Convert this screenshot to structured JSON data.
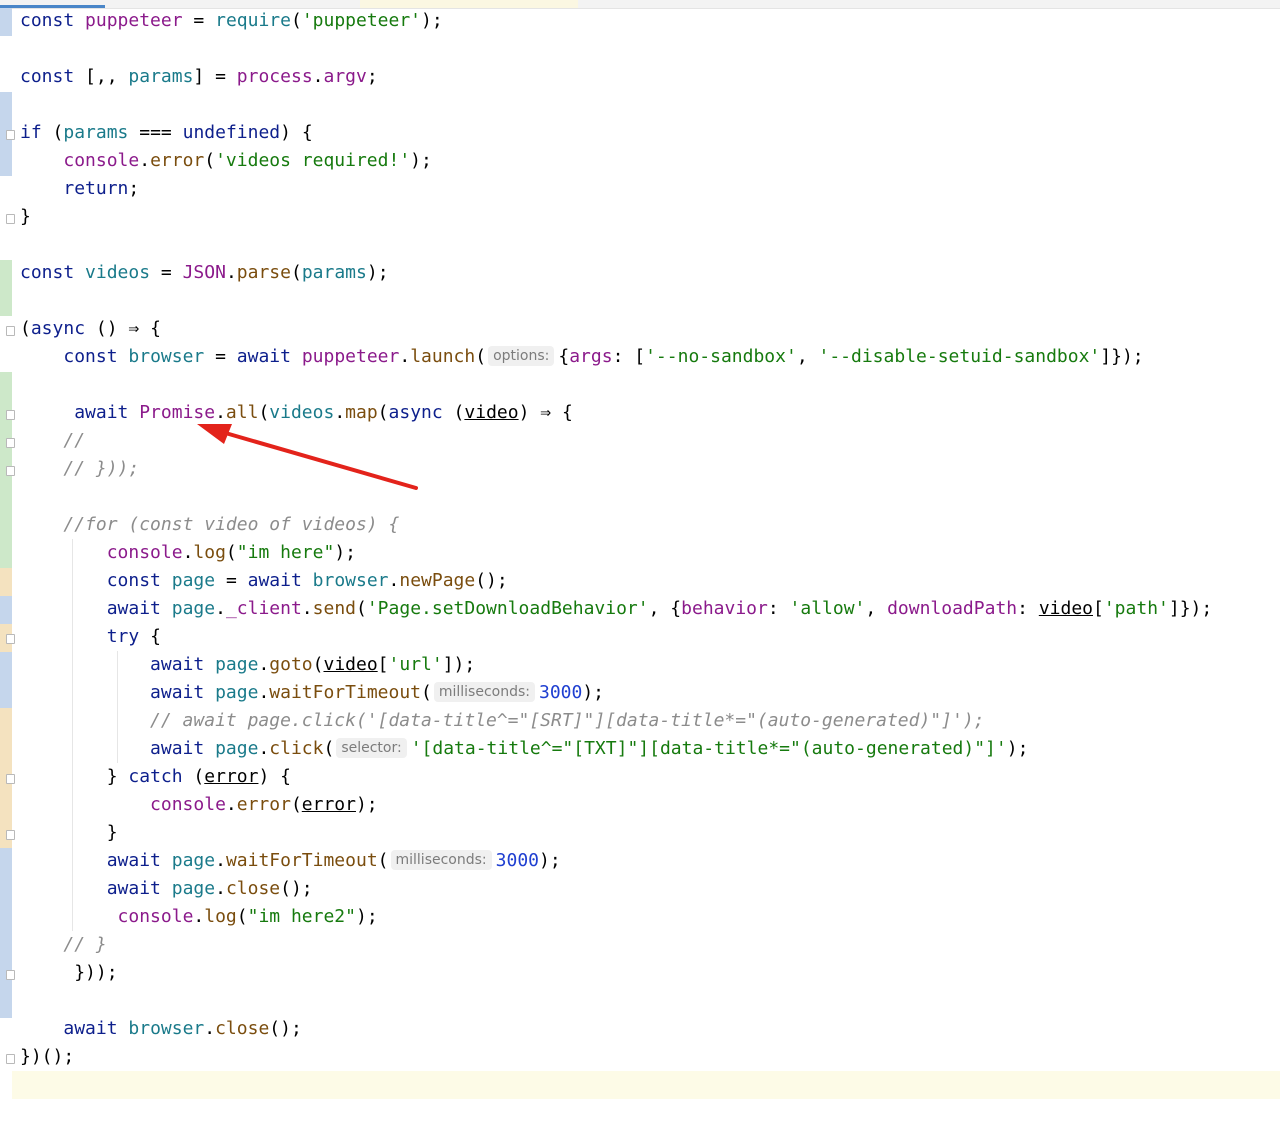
{
  "code": {
    "l1": {
      "kw": "const",
      "v": "puppeteer",
      "eq": "=",
      "fn": "require",
      "open": "(",
      "str": "'puppeteer'",
      "end": ");"
    },
    "l3": {
      "kw": "const",
      "open": "[,,",
      "v": "params",
      "close": "]",
      "eq": "=",
      "obj": "process",
      "dot": ".",
      "prop": "argv",
      "end": ";"
    },
    "l5": {
      "kw": "if",
      "open": "(",
      "v": "params",
      "op": "===",
      "lit": "undefined",
      "close": ")",
      "brace": "{"
    },
    "l6": {
      "obj": "console",
      "dot": ".",
      "fn": "error",
      "open": "(",
      "str": "'videos required!'",
      "end": ");"
    },
    "l7": {
      "kw": "return",
      "end": ";"
    },
    "l8": {
      "brace": "}"
    },
    "l10": {
      "kw": "const",
      "v": "videos",
      "eq": "=",
      "obj": "JSON",
      "dot": ".",
      "fn": "parse",
      "open": "(",
      "arg": "params",
      "end": ");"
    },
    "l12": {
      "open": "(",
      "kw": "async",
      "params": "()",
      "arrow": "⇒",
      "brace": "{"
    },
    "l13": {
      "kw": "const",
      "v": "browser",
      "eq": "=",
      "kw2": "await",
      "obj": "puppeteer",
      "dot": ".",
      "fn": "launch",
      "open": "(",
      "hint": "options:",
      "o1": "{",
      "key": "args",
      "colon": ":",
      "o2": "[",
      "s1": "'--no-sandbox'",
      "comma": ",",
      "s2": "'--disable-setuid-sandbox'",
      "end": "]});"
    },
    "l15": {
      "kw": "await",
      "cls": "Promise",
      "dot": ".",
      "fn": "all",
      "open": "(",
      "obj": "videos",
      "dot2": ".",
      "fn2": "map",
      "open2": "(",
      "kw2": "async",
      "p1": "(",
      "param": "video",
      "p2": ")",
      "arrow": "⇒",
      "brace": "{"
    },
    "l16": {
      "cm": "//"
    },
    "l17": {
      "cm": "// }));"
    },
    "l19": {
      "cm": "//for (const video of videos) {"
    },
    "l20": {
      "obj": "console",
      "dot": ".",
      "fn": "log",
      "open": "(",
      "str": "\"im here\"",
      "end": ");"
    },
    "l21": {
      "kw": "const",
      "v": "page",
      "eq": "=",
      "kw2": "await",
      "obj": "browser",
      "dot": ".",
      "fn": "newPage",
      "end": "();"
    },
    "l22": {
      "kw": "await",
      "obj": "page",
      "dot": ".",
      "prop": "_client",
      "dot2": ".",
      "fn": "send",
      "open": "(",
      "str": "'Page.setDownloadBehavior'",
      "comma": ",",
      "o1": "{",
      "k1": "behavior",
      "c1": ":",
      "s2": "'allow'",
      "comma2": ",",
      "k2": "downloadPath",
      "c2": ":",
      "param": "video",
      "b1": "[",
      "s3": "'path'",
      "end": "]});"
    },
    "l23": {
      "kw": "try",
      "brace": "{"
    },
    "l24": {
      "kw": "await",
      "obj": "page",
      "dot": ".",
      "fn": "goto",
      "open": "(",
      "param": "video",
      "b1": "[",
      "str": "'url'",
      "end": "]);"
    },
    "l25": {
      "kw": "await",
      "obj": "page",
      "dot": ".",
      "fn": "waitForTimeout",
      "open": "(",
      "hint": "milliseconds:",
      "num": "3000",
      "end": ");"
    },
    "l26": {
      "cm": "// await page.click('[data-title^=\"[SRT]\"][data-title*=\"(auto-generated)\"]');"
    },
    "l27": {
      "kw": "await",
      "obj": "page",
      "dot": ".",
      "fn": "click",
      "open": "(",
      "hint": "selector:",
      "str": "'[data-title^=\"[TXT]\"][data-title*=\"(auto-generated)\"]'",
      "end": ");"
    },
    "l28": {
      "brace": "}",
      "kw": "catch",
      "p1": "(",
      "param": "error",
      "p2": ")",
      "brace2": "{"
    },
    "l29": {
      "obj": "console",
      "dot": ".",
      "fn": "error",
      "open": "(",
      "param": "error",
      "end": ");"
    },
    "l30": {
      "brace": "}"
    },
    "l31": {
      "kw": "await",
      "obj": "page",
      "dot": ".",
      "fn": "waitForTimeout",
      "open": "(",
      "hint": "milliseconds:",
      "num": "3000",
      "end": ");"
    },
    "l32": {
      "kw": "await",
      "obj": "page",
      "dot": ".",
      "fn": "close",
      "end": "();"
    },
    "l33": {
      "obj": "console",
      "dot": ".",
      "fn": "log",
      "open": "(",
      "str": "\"im here2\"",
      "end": ");"
    },
    "l34": {
      "cm": "// }"
    },
    "l35": {
      "end": "}));"
    },
    "l37": {
      "kw": "await",
      "obj": "browser",
      "dot": ".",
      "fn": "close",
      "end": "();"
    },
    "l38": {
      "end": "})();"
    }
  },
  "colors": {
    "keyword": "#0d1f8c",
    "variable": "#1a7a8a",
    "method": "#7a4d0e",
    "global": "#8b1a8b",
    "string": "#167a0e",
    "number": "#1f3fd1",
    "comment": "#8c8c8c",
    "annotation_arrow": "#e3231b"
  }
}
